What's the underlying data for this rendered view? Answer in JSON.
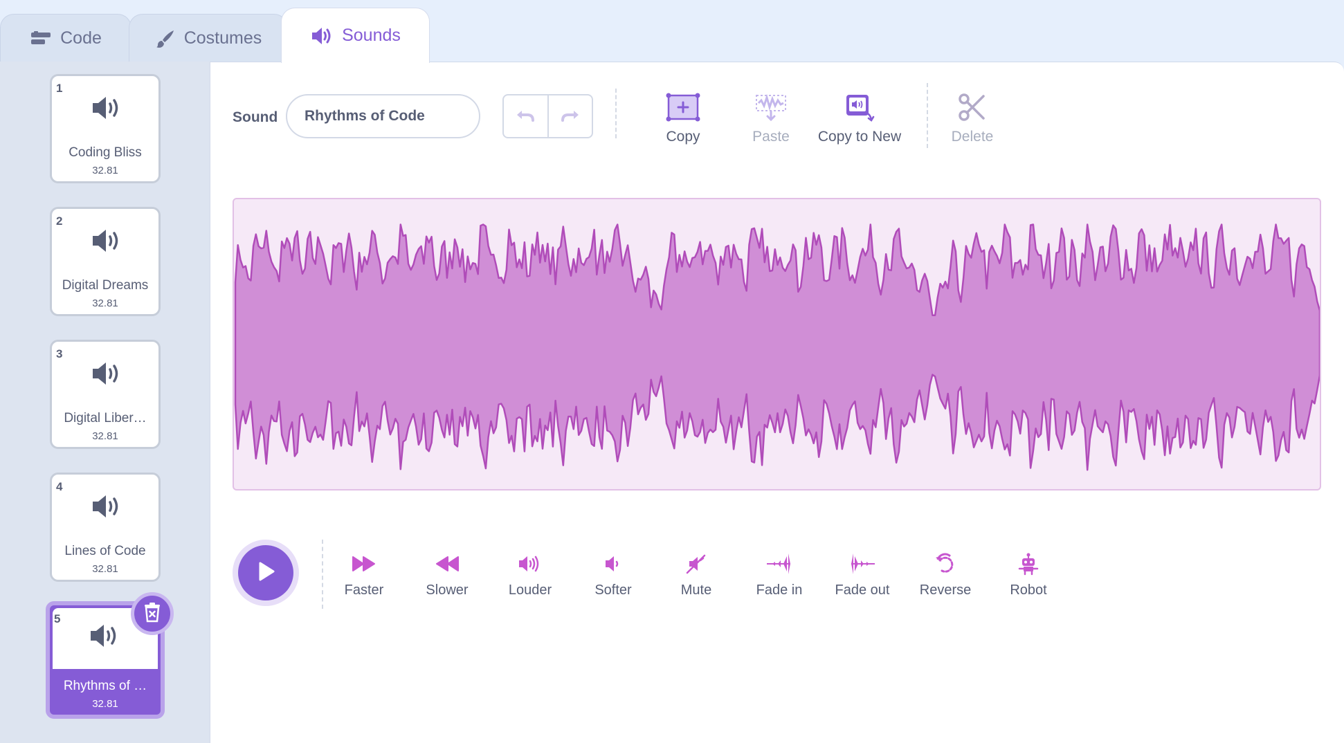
{
  "tabs": [
    {
      "label": "Code",
      "icon": "code-blocks-icon"
    },
    {
      "label": "Costumes",
      "icon": "paintbrush-icon"
    },
    {
      "label": "Sounds",
      "icon": "speaker-icon",
      "active": true
    }
  ],
  "sounds": [
    {
      "number": "1",
      "name": "Coding Bliss",
      "duration": "32.81"
    },
    {
      "number": "2",
      "name": "Digital Dreams",
      "duration": "32.81"
    },
    {
      "number": "3",
      "name": "Digital Liber…",
      "duration": "32.81"
    },
    {
      "number": "4",
      "name": "Lines of Code",
      "duration": "32.81"
    },
    {
      "number": "5",
      "name": "Rhythms of …",
      "duration": "32.81",
      "selected": true
    }
  ],
  "editor": {
    "sound_label": "Sound",
    "sound_name": "Rhythms of Code",
    "tools": [
      {
        "label": "Copy",
        "icon": "copy-selection-icon",
        "enabled": true
      },
      {
        "label": "Paste",
        "icon": "paste-icon",
        "enabled": false
      },
      {
        "label": "Copy to New",
        "icon": "copy-to-new-icon",
        "enabled": true
      },
      {
        "label": "Delete",
        "icon": "scissors-icon",
        "enabled": false
      }
    ],
    "effects": [
      {
        "label": "Faster",
        "icon": "fast-forward-icon"
      },
      {
        "label": "Slower",
        "icon": "rewind-icon"
      },
      {
        "label": "Louder",
        "icon": "louder-icon"
      },
      {
        "label": "Softer",
        "icon": "softer-icon"
      },
      {
        "label": "Mute",
        "icon": "mute-icon"
      },
      {
        "label": "Fade in",
        "icon": "fade-in-icon"
      },
      {
        "label": "Fade out",
        "icon": "fade-out-icon"
      },
      {
        "label": "Reverse",
        "icon": "reverse-icon"
      },
      {
        "label": "Robot",
        "icon": "robot-icon"
      }
    ]
  },
  "colors": {
    "accent": "#855cd6",
    "waveform_fill": "#d08ed6",
    "waveform_stroke": "#b04cb9",
    "waveform_bg": "#f6e9f7"
  }
}
